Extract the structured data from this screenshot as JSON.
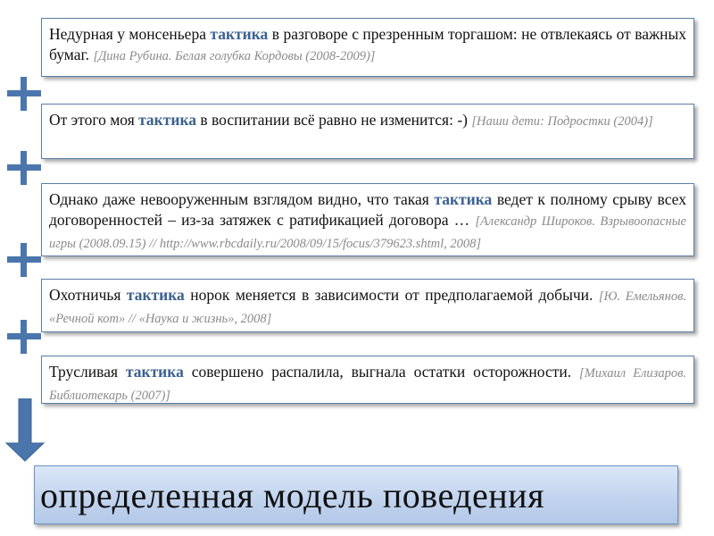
{
  "examples": [
    {
      "before": "Недурная у монсеньера ",
      "keyword": "тактика",
      "after": " в разговоре с презренным торгашом: не отвлекаясь от важных бумаг. ",
      "source": "[Дина Рубина. Белая голубка Кордовы (2008-2009)]"
    },
    {
      "before": "От этого моя ",
      "keyword": "тактика",
      "after": " в воспитании всё равно не изменится: -) ",
      "source": "[Наши дети: Подростки (2004)]"
    },
    {
      "before": "Однако даже невооруженным взглядом видно, что такая ",
      "keyword": "тактика",
      "after": " ведет к полному срыву всех договоренностей – из-за затяжек с ратификацией договора … ",
      "source": "[Александр Широков. Взрывоопасные игры (2008.09.15) // http://www.rbcdaily.ru/2008/09/15/focus/379623.shtml, 2008]"
    },
    {
      "before": "Охотничья ",
      "keyword": "тактика",
      "after": " норок меняется в зависимости от предполагаемой добычи. ",
      "source": "[Ю. Емельянов. «Речной кот» // «Наука и жизнь», 2008]"
    },
    {
      "before": "Трусливая ",
      "keyword": "тактика",
      "after": " совершено распалила, выгнала остатки осторожности. ",
      "source": "[Михаил Елизаров. Библиотекарь (2007)]"
    }
  ],
  "conclusion": "определенная модель поведения",
  "icons": {
    "plus": "plus-icon",
    "arrow": "arrow-down-icon"
  },
  "colors": {
    "keyword": "#3b6190",
    "accent": "#4a76ac",
    "source": "#8a8a8a",
    "border": "#5b7ea8"
  }
}
